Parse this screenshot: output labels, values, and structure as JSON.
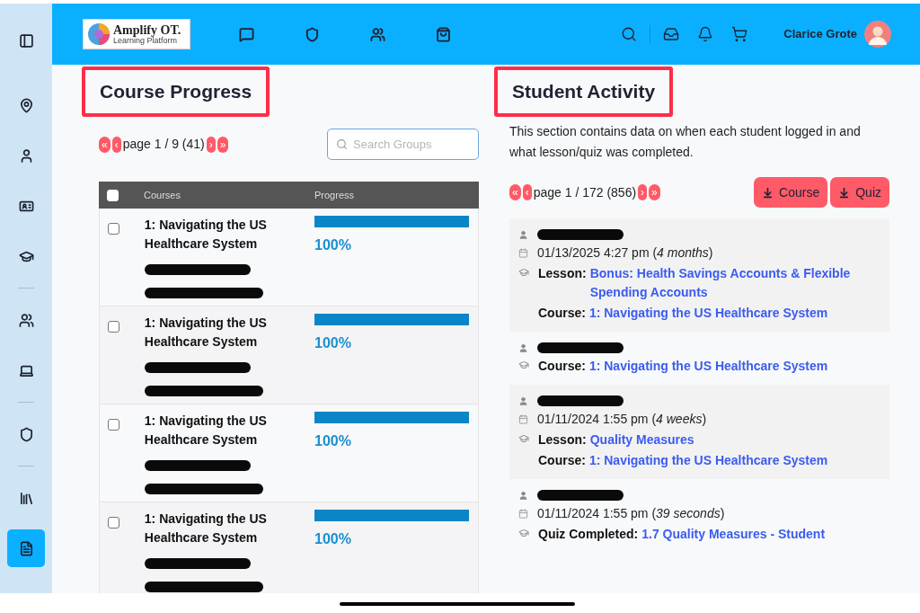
{
  "sidebar": {
    "items": [
      {
        "kind": "toggle",
        "selected": false
      },
      {
        "kind": "pin",
        "selected": false
      },
      {
        "kind": "person",
        "selected": false
      },
      {
        "kind": "card",
        "selected": false
      },
      {
        "kind": "cap",
        "selected": false
      },
      {
        "kind": "divider"
      },
      {
        "kind": "users",
        "selected": false
      },
      {
        "kind": "laptop",
        "selected": false
      },
      {
        "kind": "divider"
      },
      {
        "kind": "badge",
        "selected": false
      },
      {
        "kind": "divider"
      },
      {
        "kind": "books",
        "selected": false
      },
      {
        "kind": "report",
        "selected": true
      }
    ]
  },
  "header": {
    "logo": {
      "name": "Amplify OT.",
      "tagline": "Learning Platform"
    },
    "nav": [
      {
        "kind": "chat"
      },
      {
        "kind": "badge"
      },
      {
        "kind": "users"
      },
      {
        "kind": "bag"
      }
    ],
    "tools": [
      {
        "kind": "search"
      },
      {
        "kind": "inbox"
      },
      {
        "kind": "bell"
      },
      {
        "kind": "cart"
      }
    ],
    "user": {
      "name": "Clarice Grote"
    }
  },
  "course_progress": {
    "title": "Course Progress",
    "pagination": {
      "first": "«",
      "prev": "‹",
      "label": "page 1 / 9 (41)",
      "next": "›",
      "last": "»"
    },
    "search": {
      "placeholder": "Search Groups"
    },
    "table": {
      "columns": [
        "Courses",
        "Progress"
      ],
      "header_checked": false,
      "rows": [
        {
          "checked": false,
          "course": "1: Navigating the US Healthcare System",
          "level": 1,
          "reading": "100%"
        },
        {
          "checked": false,
          "course": "1: Navigating the US Healthcare System",
          "level": 1,
          "reading": "100%"
        },
        {
          "checked": false,
          "course": "1: Navigating the US Healthcare System",
          "level": 1,
          "reading": "100%"
        },
        {
          "checked": false,
          "course": "1: Navigating the US Healthcare System",
          "level": 1,
          "reading": "100%"
        }
      ]
    }
  },
  "student_activity": {
    "title": "Student Activity",
    "description": "This section contains data on when each student logged in and what lesson/quiz was completed.",
    "pagination": {
      "first": "«",
      "prev": "‹",
      "label": "page 1 / 172 (856)",
      "next": "›",
      "last": "»"
    },
    "buttons": [
      "Course",
      "Quiz"
    ],
    "entries": [
      {
        "date": "01/13/2025 4:27 pm (*4 months*)",
        "details": [
          {
            "label": "Lesson:",
            "value": "Bonus: Health Savings Accounts & Flexible Spending Accounts"
          },
          {
            "label": "Course:",
            "value": "1: Navigating the US Healthcare System"
          }
        ]
      },
      {
        "details": [
          {
            "label": "Course:",
            "value": "1: Navigating the US Healthcare System"
          }
        ]
      },
      {
        "date": "01/11/2024 1:55 pm (*4 weeks*)",
        "details": [
          {
            "label": "Lesson:",
            "value": "Quality Measures"
          },
          {
            "label": "Course:",
            "value": "1: Navigating the US Healthcare System"
          }
        ]
      },
      {
        "date": "01/11/2024 1:55 pm (*39 seconds*)",
        "details": [
          {
            "label": "Quiz Completed:",
            "value": "1.7 Quality Measures - Student"
          }
        ]
      }
    ]
  }
}
